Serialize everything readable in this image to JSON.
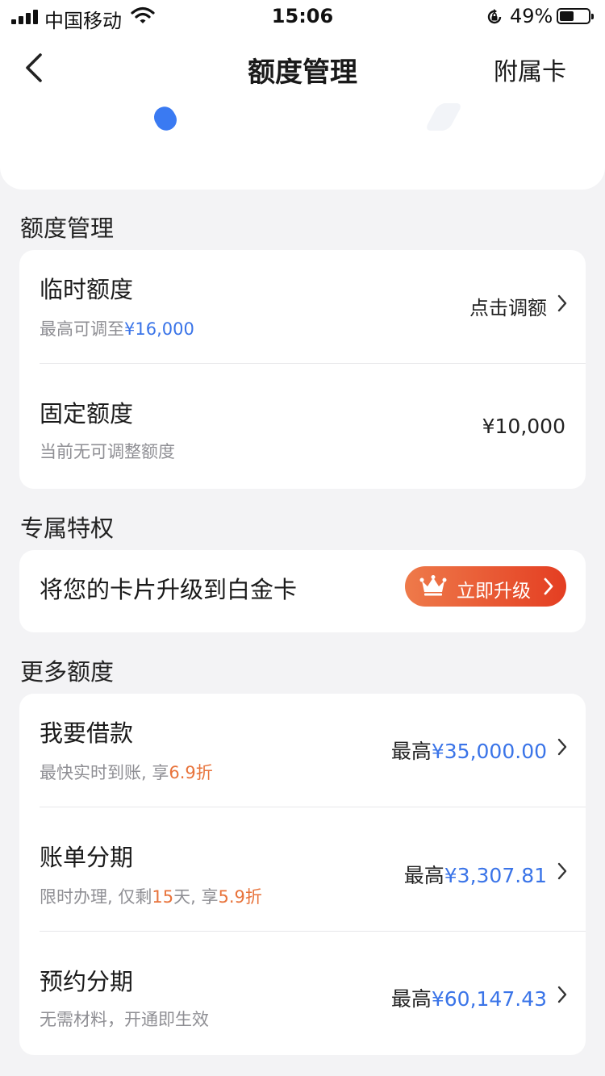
{
  "status_bar": {
    "carrier": "中国移动",
    "time": "15:06",
    "battery": "49%",
    "battery_level": 0.49
  },
  "nav": {
    "back_icon": "chevron-left-icon",
    "title": "额度管理",
    "right_action": "附属卡"
  },
  "quota_section": {
    "title": "额度管理",
    "temporary": {
      "title": "临时额度",
      "subtitle_prefix": "最高可调至",
      "subtitle_amount": "¥16,000",
      "action": "点击调额"
    },
    "fixed": {
      "title": "固定额度",
      "subtitle": "当前无可调整额度",
      "value": "¥10,000"
    }
  },
  "privilege_section": {
    "title": "专属特权",
    "text": "将您的卡片升级到白金卡",
    "button": "立即升级"
  },
  "more_section": {
    "title": "更多额度",
    "items": [
      {
        "title": "我要借款",
        "sub_a": "最快实时到账, 享",
        "sub_b": "6.9折",
        "sub_c": "",
        "sub_d": "",
        "right_prefix": "最高",
        "right_amount": "¥35,000.00"
      },
      {
        "title": "账单分期",
        "sub_a": "限时办理, 仅剩",
        "sub_b": "15",
        "sub_c": "天, 享",
        "sub_d": "5.9折",
        "right_prefix": "最高",
        "right_amount": "¥3,307.81"
      },
      {
        "title": "预约分期",
        "sub_a": "无需材料，开通即生效",
        "sub_b": "",
        "sub_c": "",
        "sub_d": "",
        "right_prefix": "最高",
        "right_amount": "¥60,147.43"
      }
    ]
  },
  "colors": {
    "accent_blue": "#3a74e8",
    "accent_orange": "#e8733b",
    "button_gradient_start": "#ee7a4a",
    "button_gradient_end": "#e43e22",
    "background": "#f3f3f5"
  }
}
